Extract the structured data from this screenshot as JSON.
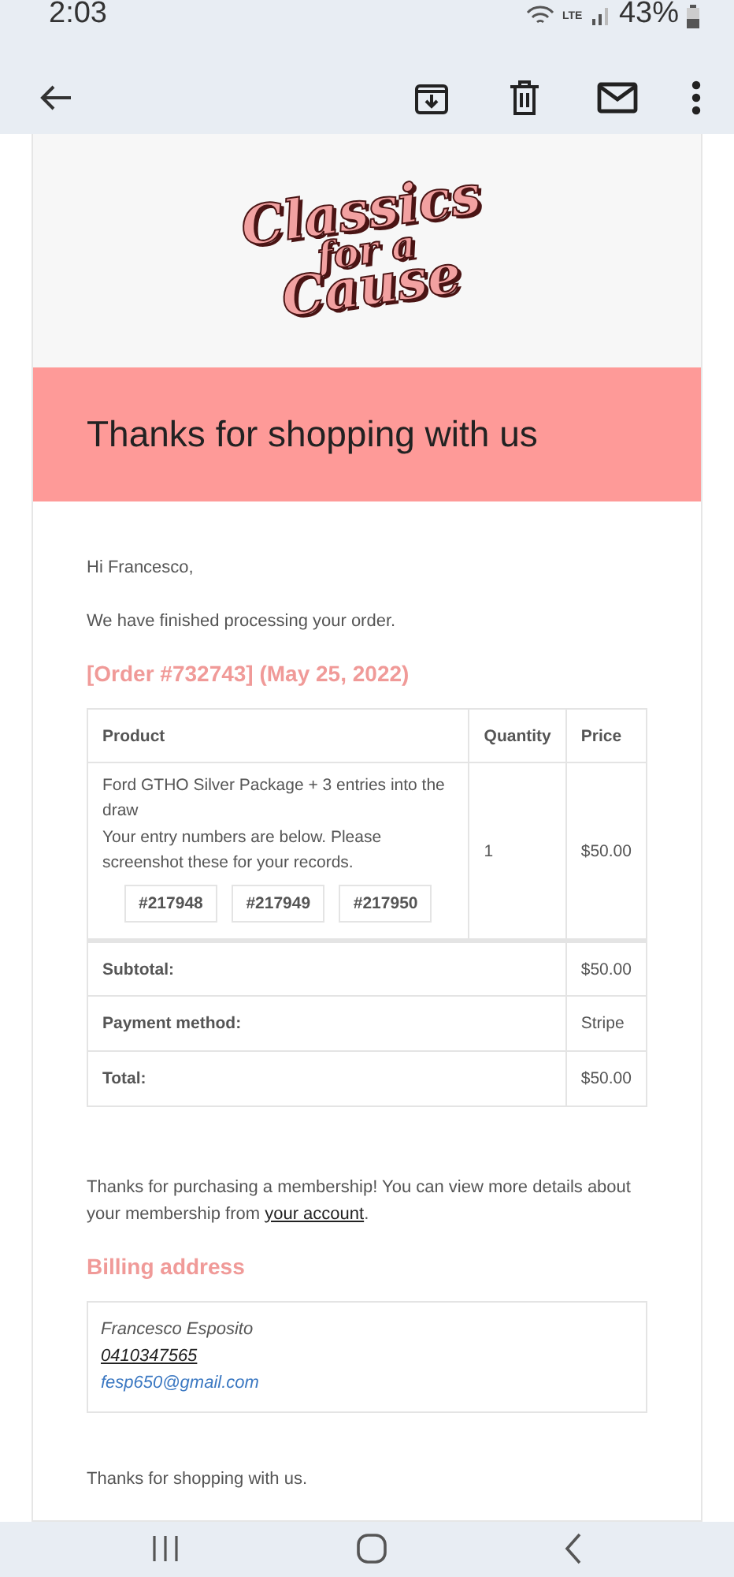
{
  "status_bar": {
    "time": "2:03",
    "network": "LTE",
    "battery": "43%"
  },
  "logo": {
    "lines": [
      "Classics",
      "for a",
      "Cause"
    ]
  },
  "banner": {
    "title": "Thanks for shopping with us"
  },
  "greeting": "Hi Francesco,",
  "intro": "We have finished processing your order.",
  "order_heading": "[Order #732743] (May 25, 2022)",
  "table": {
    "columns": [
      "Product",
      "Quantity",
      "Price"
    ],
    "items": [
      {
        "name": "Ford GTHO Silver Package + 3 entries into the draw",
        "note": "Your entry numbers are below. Please screenshot these for your records.",
        "entries": [
          "#217948",
          "#217949",
          "#217950"
        ],
        "quantity": "1",
        "price": "$50.00"
      }
    ],
    "totals": [
      {
        "label": "Subtotal:",
        "value": "$50.00"
      },
      {
        "label": "Payment method:",
        "value": "Stripe"
      },
      {
        "label": "Total:",
        "value": "$50.00"
      }
    ]
  },
  "membership": {
    "before": "Thanks for purchasing a membership! You can view more details about your membership from ",
    "link": "your account",
    "after": "."
  },
  "billing": {
    "heading": "Billing address",
    "name": "Francesco Esposito",
    "phone": "0410347565",
    "email": "fesp650@gmail.com"
  },
  "closing": "Thanks for shopping with us."
}
